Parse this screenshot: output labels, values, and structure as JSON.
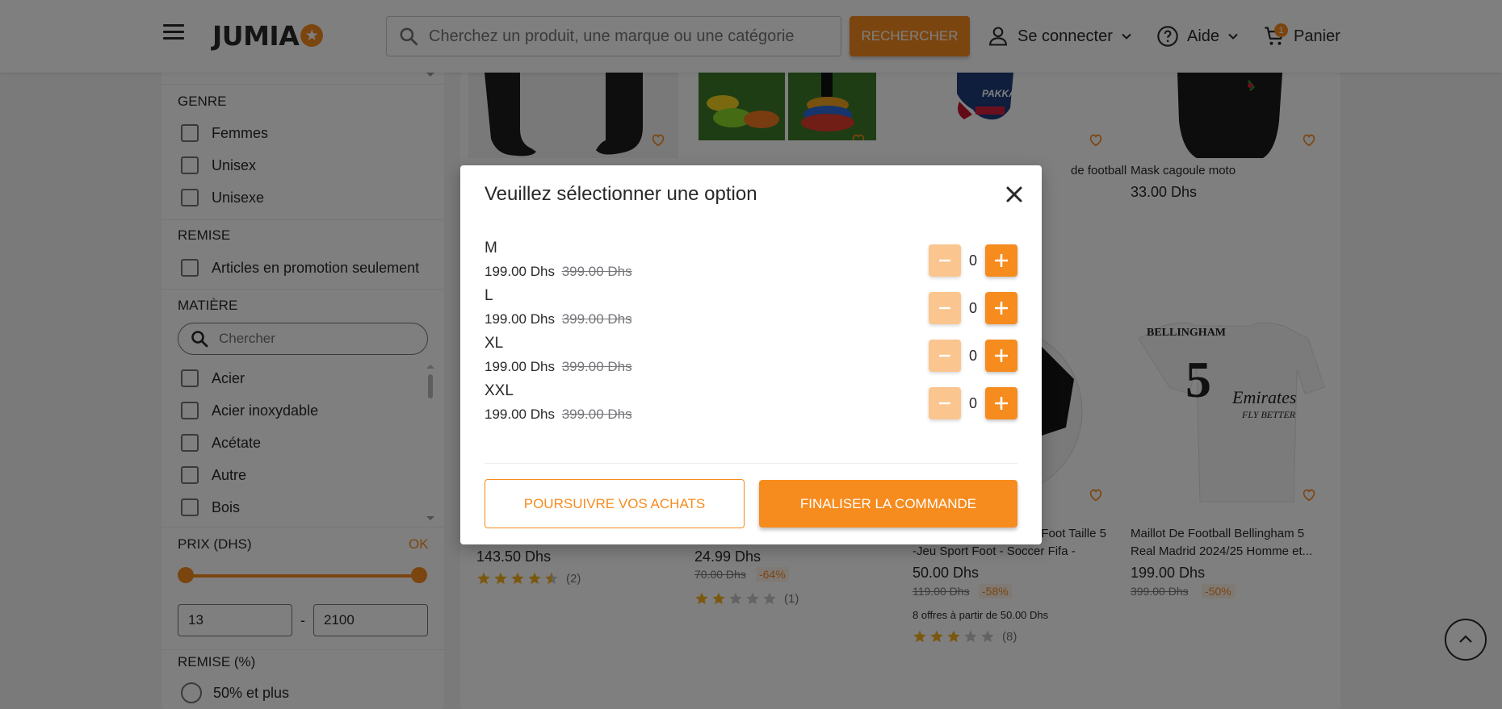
{
  "header": {
    "logo_text": "JUMIA",
    "search_placeholder": "Cherchez un produit, une marque ou une catégorie",
    "search_button": "RECHERCHER",
    "account_label": "Se connecter",
    "help_label": "Aide",
    "cart_label": "Panier",
    "cart_count": "1"
  },
  "sidebar": {
    "genre": {
      "title": "GENRE",
      "options": [
        "Femmes",
        "Unisex",
        "Unisexe"
      ]
    },
    "remise": {
      "title": "REMISE",
      "options": [
        "Articles en promotion seulement"
      ]
    },
    "matiere": {
      "title": "MATIÈRE",
      "search_placeholder": "Chercher",
      "options": [
        "Acier",
        "Acier inoxydable",
        "Acétate",
        "Autre",
        "Bois"
      ]
    },
    "prix": {
      "title": "PRIX (DHS)",
      "ok_label": "OK",
      "min": "13",
      "max": "2100",
      "dash": "-"
    },
    "remise_pct": {
      "title": "REMISE (%)",
      "options": [
        "50% et plus"
      ]
    }
  },
  "products": [
    {
      "name": "",
      "price": "143.50 Dhs",
      "old_price": "",
      "discount": "",
      "rating_count": "(2)",
      "rating": 4.5
    },
    {
      "name": "",
      "price": "24.99 Dhs",
      "old_price": "70.00 Dhs",
      "discount": "-64%",
      "rating_count": "(1)",
      "rating": 2
    },
    {
      "name_line1": "Foot Taille 5",
      "name_line2": "-Jeu Sport Foot - Soccer Fifa -",
      "price": "50.00 Dhs",
      "old_price": "119.00 Dhs",
      "discount": "-58%",
      "offers": "8  offres à partir de  50.00 Dhs",
      "rating_count": "(8)",
      "rating": 3
    },
    {
      "name_line1": "Maillot De Football Bellingham 5",
      "name_line2": "Real Madrid 2024/25 Homme et...",
      "price": "199.00 Dhs",
      "old_price": "399.00 Dhs",
      "discount": "-50%"
    },
    {
      "name": "de football",
      "price": ""
    },
    {
      "name": "Mask cagoule moto",
      "price": "33.00 Dhs"
    }
  ],
  "jersey_text": {
    "player": "BELLINGHAM",
    "number": "5",
    "sponsor": "Emirates",
    "sponsor_sub": "FLY BETTER"
  },
  "glove_text": "PAKKA",
  "modal": {
    "title": "Veuillez sélectionner une option",
    "options": [
      {
        "size": "M",
        "price": "199.00 Dhs",
        "old_price": "399.00 Dhs",
        "qty": "0"
      },
      {
        "size": "L",
        "price": "199.00 Dhs",
        "old_price": "399.00 Dhs",
        "qty": "0"
      },
      {
        "size": "XL",
        "price": "199.00 Dhs",
        "old_price": "399.00 Dhs",
        "qty": "0"
      },
      {
        "size": "XXL",
        "price": "199.00 Dhs",
        "old_price": "399.00 Dhs",
        "qty": "0"
      }
    ],
    "continue_label": "POURSUIVRE VOS ACHATS",
    "checkout_label": "FINALISER LA COMMANDE"
  },
  "colors": {
    "accent": "#f68b1e",
    "accent_light": "#fbc58f",
    "text": "#282828",
    "muted": "#75757a"
  }
}
